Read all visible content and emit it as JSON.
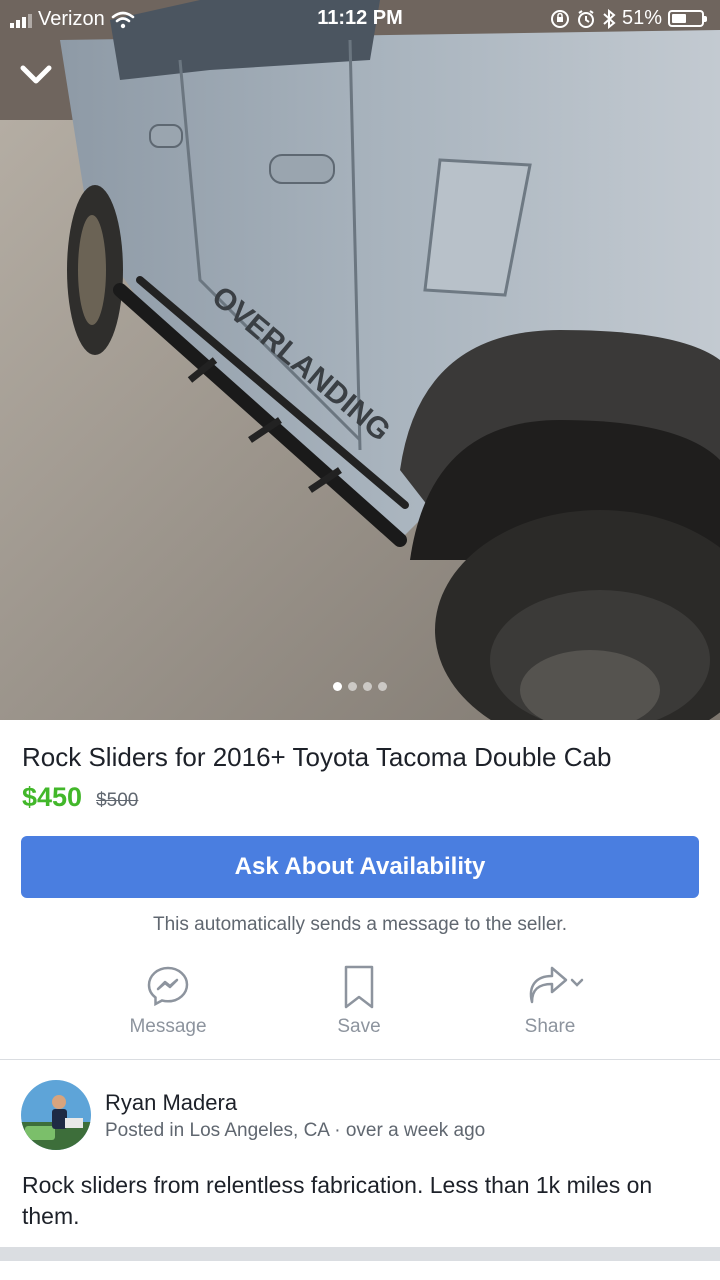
{
  "status_bar": {
    "carrier": "Verizon",
    "time": "11:12 PM",
    "battery": "51%",
    "battery_level": 0.51
  },
  "gallery": {
    "image_count": 4,
    "active_index": 0,
    "photo_text": "OVERLANDING"
  },
  "listing": {
    "title": "Rock Sliders for 2016+ Toyota Tacoma Double Cab",
    "price": "$450",
    "original_price": "$500",
    "ask_button": "Ask About Availability",
    "ask_note": "This automatically sends a message to the seller."
  },
  "actions": {
    "message": "Message",
    "save": "Save",
    "share": "Share"
  },
  "seller": {
    "name": "Ryan Madera",
    "location": "Posted in Los Angeles, CA",
    "separator": "·",
    "posted": "over a week ago"
  },
  "description": "Rock sliders from relentless fabrication. Less than 1k miles on them.",
  "colors": {
    "accent": "#4a7ee0",
    "price": "#42b72a",
    "secondary_text": "#606770"
  }
}
